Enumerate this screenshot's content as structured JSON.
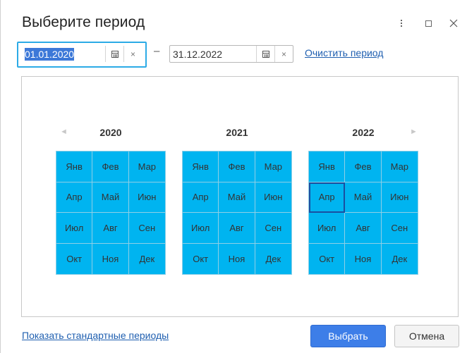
{
  "dialog": {
    "title": "Выберите период",
    "window_controls": [
      "more-icon",
      "maximize-icon",
      "close-icon"
    ]
  },
  "period": {
    "start_value": "01.01.2020",
    "end_value": "31.12.2022",
    "separator": "–",
    "clear_label": "Очистить период",
    "clear_icon": "×"
  },
  "calendar": {
    "years": [
      "2020",
      "2021",
      "2022"
    ],
    "months": [
      "Янв",
      "Фев",
      "Мар",
      "Апр",
      "Май",
      "Июн",
      "Июл",
      "Авг",
      "Сен",
      "Окт",
      "Ноя",
      "Дек"
    ],
    "selected": {
      "year": "2022",
      "month": "Апр"
    },
    "highlight_color": "#00b4f0",
    "prev_arrow": "◄",
    "next_arrow": "►"
  },
  "footer": {
    "standard_periods_label": "Показать стандартные периоды",
    "ok_label": "Выбрать",
    "cancel_label": "Отмена"
  }
}
